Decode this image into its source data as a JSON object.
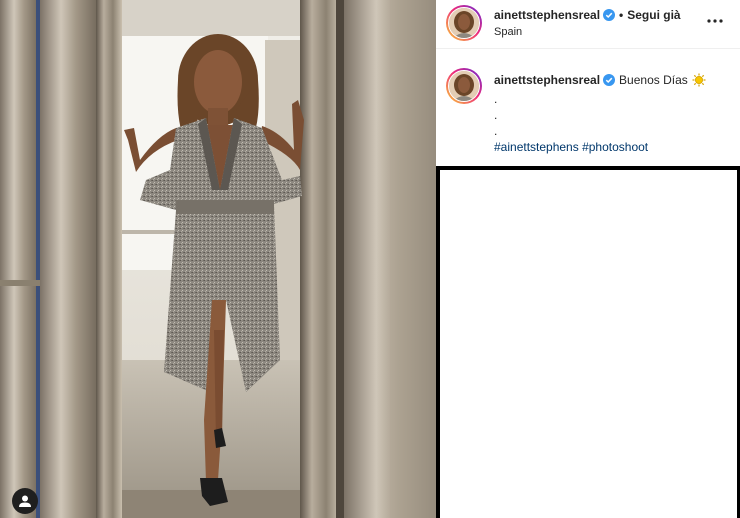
{
  "post": {
    "photo_alt": "Woman in grey coat standing in an elevator",
    "user_tags_icon": "user-icon"
  },
  "header": {
    "username": "ainettstephensreal",
    "separator": "•",
    "follow_status": "Segui già",
    "location": "Spain",
    "more_icon": "more-horizontal-icon"
  },
  "caption": {
    "username": "ainettstephensreal",
    "text": "Buenos Días",
    "emoji": "sun-emoji",
    "dot_lines": [
      ".",
      ".",
      "."
    ],
    "hashtags": [
      "#ainettstephens",
      "#photoshoot"
    ]
  },
  "colors": {
    "verified_blue": "#3897f0",
    "link_blue": "#00376b",
    "text": "#262626",
    "story_ring_start": "#f9ce34",
    "story_ring_end": "#6228d7"
  }
}
